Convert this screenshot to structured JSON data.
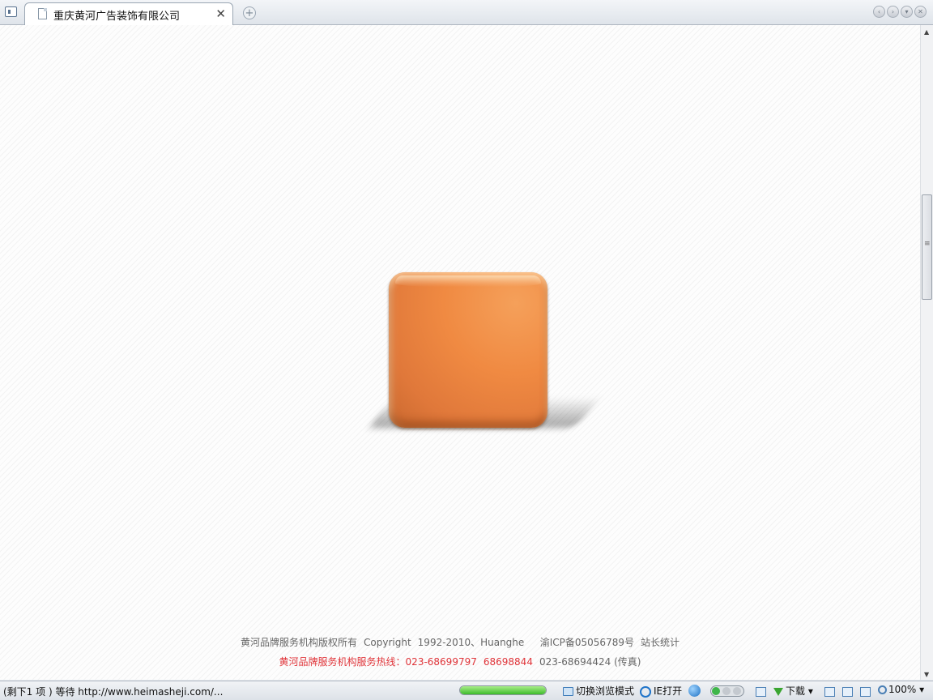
{
  "browser": {
    "tab": {
      "title": "重庆黄河广告装饰有限公司",
      "close_label": "✕"
    },
    "new_tab_label": "+",
    "window_buttons": [
      "‹",
      "›",
      "▾",
      "✕"
    ]
  },
  "page": {
    "footer": {
      "copyright": "黄河品牌服务机构版权所有",
      "copyright_word": "Copyright",
      "years": "1992-2010、Huanghe",
      "icp": "渝ICP备05056789号",
      "stats_link": "站长统计",
      "hotline_label": "黄河品牌服务机构服务热线：023-68699797",
      "hotline_2": "68698844",
      "fax": "023-68694424 (传真)"
    }
  },
  "statusbar": {
    "status_text": "(剩下1 项 ) 等待 http://www.heimasheji.com/...",
    "progress": 1.0,
    "switch_mode": "切换浏览模式",
    "ie_open": "IE打开",
    "download": "下载",
    "download_arrow": "▾",
    "zoom": "100%",
    "zoom_arrow": "▾"
  },
  "icons": [
    "sidebar-icon",
    "page-icon",
    "close-icon",
    "plus-icon",
    "back-icon",
    "forward-icon",
    "menu-icon",
    "folder-icon",
    "ie-icon",
    "globe-icon",
    "toggle-icon",
    "download-icon",
    "zoom-icon"
  ],
  "colors": {
    "accent_orange": "#f08a42",
    "hotline_red": "#e0353a",
    "progress_green": "#3dbb2a"
  }
}
